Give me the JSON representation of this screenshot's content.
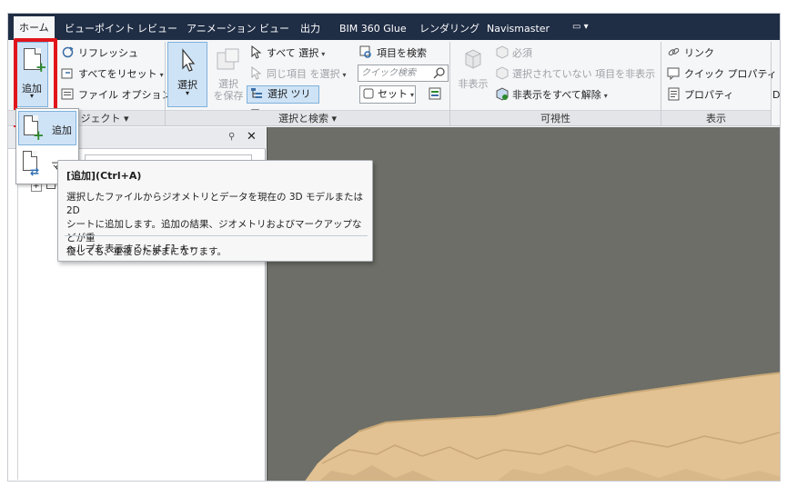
{
  "tabs": {
    "home": "ホーム",
    "viewpoint": "ビューポイント",
    "review": "レビュー",
    "animation": "アニメーション",
    "view": "ビュー",
    "output": "出力",
    "bim360": "BIM 360 Glue",
    "rendering": "レンダリング",
    "navismaster": "Navismaster",
    "extra": "▭ ▾"
  },
  "project_panel": {
    "add_label": "追加",
    "refresh": "リフレッシュ",
    "reset_all": "すべてをリセット",
    "file_options": "ファイル オプション",
    "title": "ジェクト ▾"
  },
  "select_panel": {
    "select_label": "選択",
    "save_selection_line1": "選択",
    "save_selection_line2": "を保存",
    "select_all": "すべて 選択",
    "select_same": "同じ項目 を選択",
    "selection_tree": "選択 ツリー",
    "find_items": "項目を検索",
    "quick_find_placeholder": "クイック検索",
    "sets": "セット",
    "title": "選択と検索 ▾"
  },
  "visibility_panel": {
    "hide": "非表示",
    "require": "必須",
    "hide_unselected": "選択されていない 項目を非表示",
    "unhide_all": "非表示をすべて解除",
    "title": "可視性"
  },
  "display_panel": {
    "links": "リンク",
    "quick_properties": "クイック プロパティ",
    "properties": "プロパティ",
    "title": "表示",
    "cut": "D"
  },
  "dropdown": {
    "add": "追加",
    "merge": "マー"
  },
  "tooltip": {
    "title": "[追加](Ctrl+A)",
    "line1": "選択したファイルからジオメトリとデータを現在の 3D モデルまたは 2D",
    "line2": "シートに追加します。追加の結果、ジオメトリおよびマークアップなどが重",
    "line3": "複しても、重複したままになります。",
    "help": "ヘルプを表示するには F1 キー"
  },
  "colors": {
    "tabbar": "#1f2d45",
    "highlight": "#cfe3f6",
    "red_box": "#e0161b",
    "viewport": "#6c6e67",
    "terrain": "#e2c193"
  }
}
